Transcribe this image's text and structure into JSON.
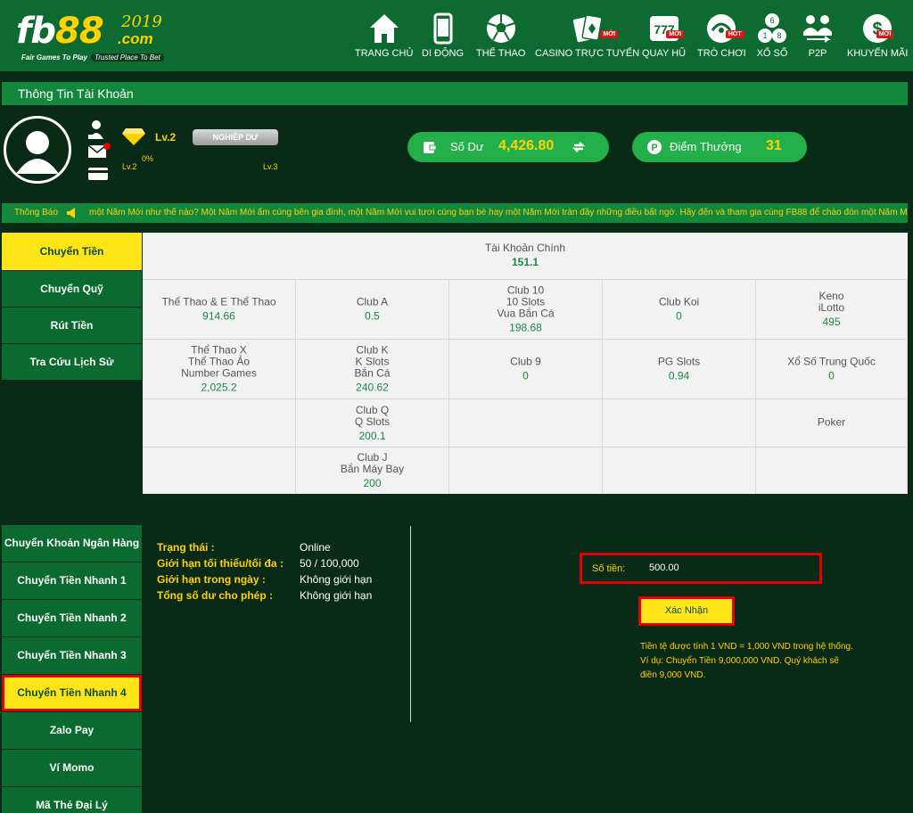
{
  "logo": {
    "brand_a": "fb",
    "brand_b": "88",
    "year": "2019",
    "com": ".com",
    "tag1": "Fair Games To Play",
    "tag2": "Trusted Place To Bet"
  },
  "nav": [
    {
      "label": "TRANG CHỦ",
      "icon": "home-icon",
      "badge": ""
    },
    {
      "label": "DI ĐỘNG",
      "icon": "mobile-icon",
      "badge": ""
    },
    {
      "label": "THỂ THAO",
      "icon": "soccer-ball-icon",
      "badge": ""
    },
    {
      "label": "CASINO TRỰC TUYẾN",
      "icon": "cards-icon",
      "badge": "MỚI"
    },
    {
      "label": "QUAY HŨ",
      "icon": "slot-777-icon",
      "badge": "MỚI"
    },
    {
      "label": "TRÒ CHƠI",
      "icon": "game-icon",
      "badge": "HOT"
    },
    {
      "label": "XỔ SỐ",
      "icon": "lottery-balls-icon",
      "badge": ""
    },
    {
      "label": "P2P",
      "icon": "p2p-icon",
      "badge": ""
    },
    {
      "label": "KHUYẾN MÃI",
      "icon": "promo-dollar-icon",
      "badge": "MỚI"
    }
  ],
  "account": {
    "title": "Thông Tin Tài Khoản",
    "level": "Lv.2",
    "level_left": "Lv.2",
    "level_right": "Lv.3",
    "progress": "0%",
    "rank": "NGHIỆP DƯ",
    "balance_label": "Số Dư",
    "balance": "4,426.80",
    "points_label": "Điểm Thưởng",
    "points": "31"
  },
  "notice": {
    "label": "Thông Báo",
    "text": "một Năm Mới như thế nào? Một Năm Mới ấm cúng bên gia đình, một Năm Mới vui tươi cùng bạn bè hay một Năm Mới tràn đầy những điều bất ngờ. Hãy đến và tham gia cùng FB88 để chào đón một Năm Mới thật trọn"
  },
  "menu1": [
    "Chuyển Tiền",
    "Chuyển Quỹ",
    "Rút Tiền",
    "Tra Cứu Lịch Sử"
  ],
  "wallets": {
    "main_label": "Tài Khoản Chính",
    "main_value": "151.1",
    "cells": [
      {
        "name": "Thể Thao & E Thể Thao",
        "value": "914.66"
      },
      {
        "name": "Club A",
        "value": "0.5"
      },
      {
        "name": "Club 10\n10 Slots\nVua Bắn Cá",
        "value": "198.68"
      },
      {
        "name": "Club Koi",
        "value": "0"
      },
      {
        "name": "Keno\niLotto",
        "value": "495"
      },
      {
        "name": "Thể Thao X\nThể Thao Ảo\nNumber Games",
        "value": "2,025.2"
      },
      {
        "name": "Club K\nK Slots\nBắn Cá",
        "value": "240.62"
      },
      {
        "name": "Club 9",
        "value": "0"
      },
      {
        "name": "PG Slots",
        "value": "0.94"
      },
      {
        "name": "Xổ Số Trung Quốc",
        "value": "0"
      },
      {
        "name": "",
        "value": ""
      },
      {
        "name": "Club Q\nQ Slots",
        "value": "200.1"
      },
      {
        "name": "",
        "value": ""
      },
      {
        "name": "",
        "value": ""
      },
      {
        "name": "Poker",
        "value": ""
      },
      {
        "name": "",
        "value": ""
      },
      {
        "name": "Club J\nBắn Máy Bay",
        "value": "200"
      },
      {
        "name": "",
        "value": ""
      },
      {
        "name": "",
        "value": ""
      },
      {
        "name": "",
        "value": ""
      }
    ]
  },
  "menu2": [
    "Chuyển Khoản Ngân Hàng",
    "Chuyển Tiền Nhanh 1",
    "Chuyển Tiền Nhanh 2",
    "Chuyển Tiền Nhanh 3",
    "Chuyển Tiền Nhanh 4",
    "Zalo Pay",
    "Ví Momo",
    "Mã Thẻ Đại Lý"
  ],
  "info": [
    {
      "k": "Trạng thái :",
      "v": "Online"
    },
    {
      "k": "Giới hạn tối thiểu/tối đa :",
      "v": "50 / 100,000"
    },
    {
      "k": "Giới hạn trong ngày :",
      "v": "Không giới hạn"
    },
    {
      "k": "Tổng số dư cho phép :",
      "v": "Không giới hạn"
    }
  ],
  "form": {
    "amount_label": "Số tiền:",
    "amount_value": "500.00",
    "confirm": "Xác Nhận",
    "note": "Tiền tệ được tính 1 VND = 1,000 VND trong hệ thống. Ví dụ: Chuyển Tiền 9,000,000 VND. Quý khách sẽ điền 9,000 VND."
  },
  "colors": {
    "header": "#0d6b31",
    "accent": "#ffe418",
    "highlight": "#e20000",
    "value_green": "#17883f"
  }
}
